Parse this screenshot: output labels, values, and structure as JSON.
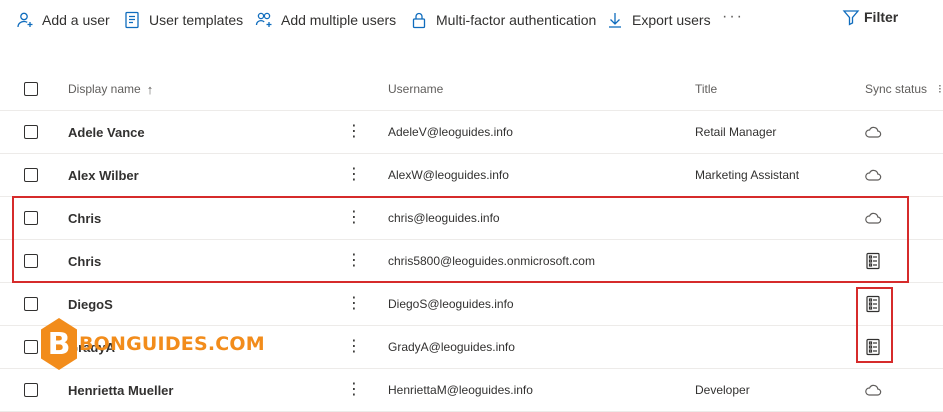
{
  "toolbar": {
    "add_user": {
      "label": "Add a user",
      "icon": "add-user-icon"
    },
    "user_templates": {
      "label": "User templates",
      "icon": "template-icon"
    },
    "add_multiple": {
      "label": "Add multiple users",
      "icon": "add-multiple-users-icon"
    },
    "mfa": {
      "label": "Multi-factor authentication",
      "icon": "lock-icon"
    },
    "export": {
      "label": "Export users",
      "icon": "download-icon"
    },
    "more": "···",
    "filter": {
      "label": "Filter",
      "icon": "filter-icon"
    }
  },
  "table": {
    "headers": {
      "display_name": "Display name",
      "sort_indicator": "↑",
      "username": "Username",
      "title": "Title",
      "sync_status": "Sync status"
    },
    "rows": [
      {
        "name": "Adele Vance",
        "username": "AdeleV@leoguides.info",
        "title": "Retail Manager",
        "sync": "cloud-icon",
        "more": "⋮"
      },
      {
        "name": "Alex Wilber",
        "username": "AlexW@leoguides.info",
        "title": "Marketing Assistant",
        "sync": "cloud-icon",
        "more": "⋮"
      },
      {
        "name": "Chris",
        "username": "chris@leoguides.info",
        "title": "",
        "sync": "cloud-icon",
        "more": "⋮"
      },
      {
        "name": "Chris",
        "username": "chris5800@leoguides.onmicrosoft.com",
        "title": "",
        "sync": "directory-sync-icon",
        "more": "⋮"
      },
      {
        "name": "DiegoS",
        "username": "DiegoS@leoguides.info",
        "title": "",
        "sync": "directory-sync-icon",
        "more": "⋮"
      },
      {
        "name": "GradyA",
        "username": "GradyA@leoguides.info",
        "title": "",
        "sync": "directory-sync-icon",
        "more": "⋮"
      },
      {
        "name": "Henrietta Mueller",
        "username": "HenriettaM@leoguides.info",
        "title": "Developer",
        "sync": "cloud-icon",
        "more": "⋮"
      }
    ]
  },
  "watermark": {
    "letter": "B",
    "text": "BONGUIDES.COM"
  },
  "colors": {
    "highlight": "#d62b2b",
    "accent": "#0f6cbd",
    "watermark": "#f28c1b"
  }
}
